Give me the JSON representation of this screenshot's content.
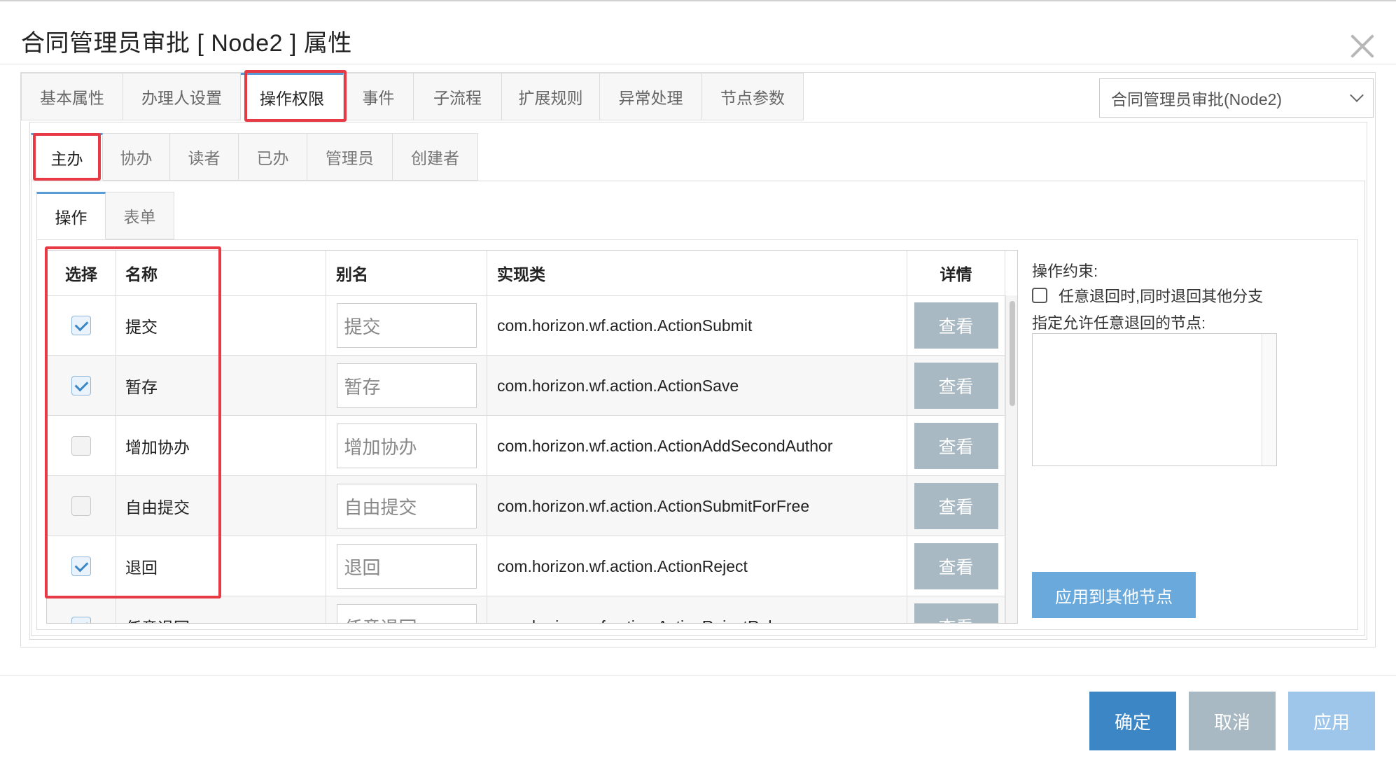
{
  "dialog": {
    "title": "合同管理员审批 [ Node2 ] 属性"
  },
  "main_tabs": [
    {
      "label": "基本属性",
      "width": 146
    },
    {
      "label": "办理人设置",
      "width": 168
    },
    {
      "label": "操作权限",
      "width": 147,
      "active": true
    },
    {
      "label": "事件",
      "width": 100
    },
    {
      "label": "子流程",
      "width": 126
    },
    {
      "label": "扩展规则",
      "width": 140
    },
    {
      "label": "异常处理",
      "width": 146
    },
    {
      "label": "节点参数",
      "width": 145
    }
  ],
  "node_select": {
    "value": "合同管理员审批(Node2)"
  },
  "role_tabs": [
    {
      "label": "主办",
      "width": 103,
      "active": true
    },
    {
      "label": "协办",
      "width": 96
    },
    {
      "label": "读者",
      "width": 98
    },
    {
      "label": "已办",
      "width": 98
    },
    {
      "label": "管理员",
      "width": 122
    },
    {
      "label": "创建者",
      "width": 122
    }
  ],
  "sub_tabs": [
    {
      "label": "操作",
      "width": 99,
      "active": true
    },
    {
      "label": "表单",
      "width": 98
    }
  ],
  "table": {
    "headers": {
      "select": "选择",
      "name": "名称",
      "alias": "别名",
      "impl": "实现类",
      "detail": "详情"
    },
    "rows": [
      {
        "checked": true,
        "name": "提交",
        "alias": "提交",
        "impl": "com.horizon.wf.action.ActionSubmit",
        "detail": "查看"
      },
      {
        "checked": true,
        "name": "暂存",
        "alias": "暂存",
        "impl": "com.horizon.wf.action.ActionSave",
        "detail": "查看"
      },
      {
        "checked": false,
        "name": "增加协办",
        "alias": "增加协办",
        "impl": "com.horizon.wf.action.ActionAddSecondAuthor",
        "detail": "查看"
      },
      {
        "checked": false,
        "name": "自由提交",
        "alias": "自由提交",
        "impl": "com.horizon.wf.action.ActionSubmitForFree",
        "detail": "查看"
      },
      {
        "checked": true,
        "name": "退回",
        "alias": "退回",
        "impl": "com.horizon.wf.action.ActionReject",
        "detail": "查看"
      },
      {
        "checked": true,
        "name": "任意退回",
        "alias": "任意退回",
        "impl": "com.horizon.wf.action.ActionRejectRule",
        "detail": "查看"
      }
    ]
  },
  "constraints": {
    "label": "操作约束:",
    "checkbox_text": "任意退回时,同时退回其他分支",
    "nodes_label": "指定允许任意退回的节点:",
    "apply_other_label": "应用到其他节点"
  },
  "footer": {
    "ok_label": "确定",
    "cancel_label": "取消",
    "apply_label": "应用"
  },
  "colors": {
    "accent": "#3d86c6",
    "highlight": "#e83a45",
    "detail_button": "#a9b9c3"
  }
}
